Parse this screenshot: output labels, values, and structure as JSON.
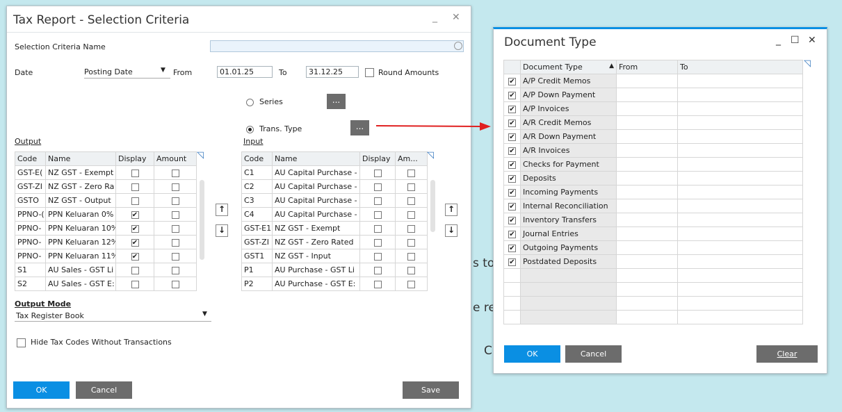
{
  "background_fragments": [
    "s to",
    "e re",
    "C"
  ],
  "tax_window": {
    "title": "Tax Report - Selection Criteria",
    "minimize": "_",
    "close": "✕",
    "criteria_name_label": "Selection Criteria Name",
    "criteria_name_value": "",
    "date_label": "Date",
    "date_type": "Posting Date",
    "from_label": "From",
    "from_value": "01.01.25",
    "to_label": "To",
    "to_value": "31.12.25",
    "round_amounts_label": "Round Amounts",
    "series_label": "Series",
    "trans_type_label": "Trans. Type",
    "ellipsis": "...",
    "output_label": "Output",
    "input_label": "Input",
    "output_headers": [
      "Code",
      "Name",
      "Display",
      "Amount"
    ],
    "output_rows": [
      {
        "code": "GST-E(",
        "name": "NZ GST - Exempt",
        "display": false,
        "amount": false
      },
      {
        "code": "GST-ZI",
        "name": "NZ GST - Zero Ra",
        "display": false,
        "amount": false
      },
      {
        "code": "GSTO",
        "name": "NZ GST - Output",
        "display": false,
        "amount": false
      },
      {
        "code": "PPNO-(",
        "name": "PPN Keluaran 0%",
        "display": true,
        "amount": false
      },
      {
        "code": "PPNO-",
        "name": "PPN Keluaran 10%",
        "display": true,
        "amount": false
      },
      {
        "code": "PPNO-",
        "name": "PPN Keluaran 12%",
        "display": true,
        "amount": false
      },
      {
        "code": "PPNO-",
        "name": "PPN Keluaran 11%",
        "display": true,
        "amount": false
      },
      {
        "code": "S1",
        "name": "AU Sales - GST Li",
        "display": false,
        "amount": false
      },
      {
        "code": "S2",
        "name": "AU Sales - GST E:",
        "display": false,
        "amount": false
      }
    ],
    "input_headers": [
      "Code",
      "Name",
      "Display",
      "Am..."
    ],
    "input_rows": [
      {
        "code": "C1",
        "name": "AU Capital Purchase -",
        "display": false,
        "amount": false
      },
      {
        "code": "C2",
        "name": "AU Capital Purchase -",
        "display": false,
        "amount": false
      },
      {
        "code": "C3",
        "name": "AU Capital Purchase -",
        "display": false,
        "amount": false
      },
      {
        "code": "C4",
        "name": "AU Capital Purchase -",
        "display": false,
        "amount": false
      },
      {
        "code": "GST-E1",
        "name": "NZ GST - Exempt",
        "display": false,
        "amount": false
      },
      {
        "code": "GST-ZI",
        "name": "NZ GST - Zero Rated",
        "display": false,
        "amount": false
      },
      {
        "code": "GST1",
        "name": "NZ GST - Input",
        "display": false,
        "amount": false
      },
      {
        "code": "P1",
        "name": "AU Purchase - GST Li",
        "display": false,
        "amount": false
      },
      {
        "code": "P2",
        "name": "AU Purchase - GST E:",
        "display": false,
        "amount": false
      }
    ],
    "output_mode_label": "Output Mode",
    "output_mode_value": "Tax Register Book",
    "hide_tax_codes_label": "Hide Tax Codes Without Transactions",
    "ok_label": "OK",
    "cancel_label": "Cancel",
    "save_label": "Save"
  },
  "doc_window": {
    "title": "Document Type",
    "minimize": "_",
    "maximize": "☐",
    "close": "✕",
    "headers": [
      "Document Type",
      "From",
      "To"
    ],
    "sort_indicator": "▲",
    "rows": [
      {
        "type": "A/P Credit Memos",
        "checked": true
      },
      {
        "type": "A/P Down Payment",
        "checked": true
      },
      {
        "type": "A/P Invoices",
        "checked": true
      },
      {
        "type": "A/R Credit Memos",
        "checked": true
      },
      {
        "type": "A/R Down Payment",
        "checked": true
      },
      {
        "type": "A/R Invoices",
        "checked": true
      },
      {
        "type": "Checks for Payment",
        "checked": true
      },
      {
        "type": "Deposits",
        "checked": true
      },
      {
        "type": "Incoming Payments",
        "checked": true
      },
      {
        "type": "Internal Reconciliation",
        "checked": true
      },
      {
        "type": "Inventory Transfers",
        "checked": true
      },
      {
        "type": "Journal Entries",
        "checked": true
      },
      {
        "type": "Outgoing Payments",
        "checked": true
      },
      {
        "type": "Postdated Deposits",
        "checked": true
      }
    ],
    "empty_rows": 4,
    "ok_label": "OK",
    "cancel_label": "Cancel",
    "clear_label": "Clear"
  },
  "colors": {
    "accent": "#0a8fe3",
    "arrow": "#e02020"
  }
}
